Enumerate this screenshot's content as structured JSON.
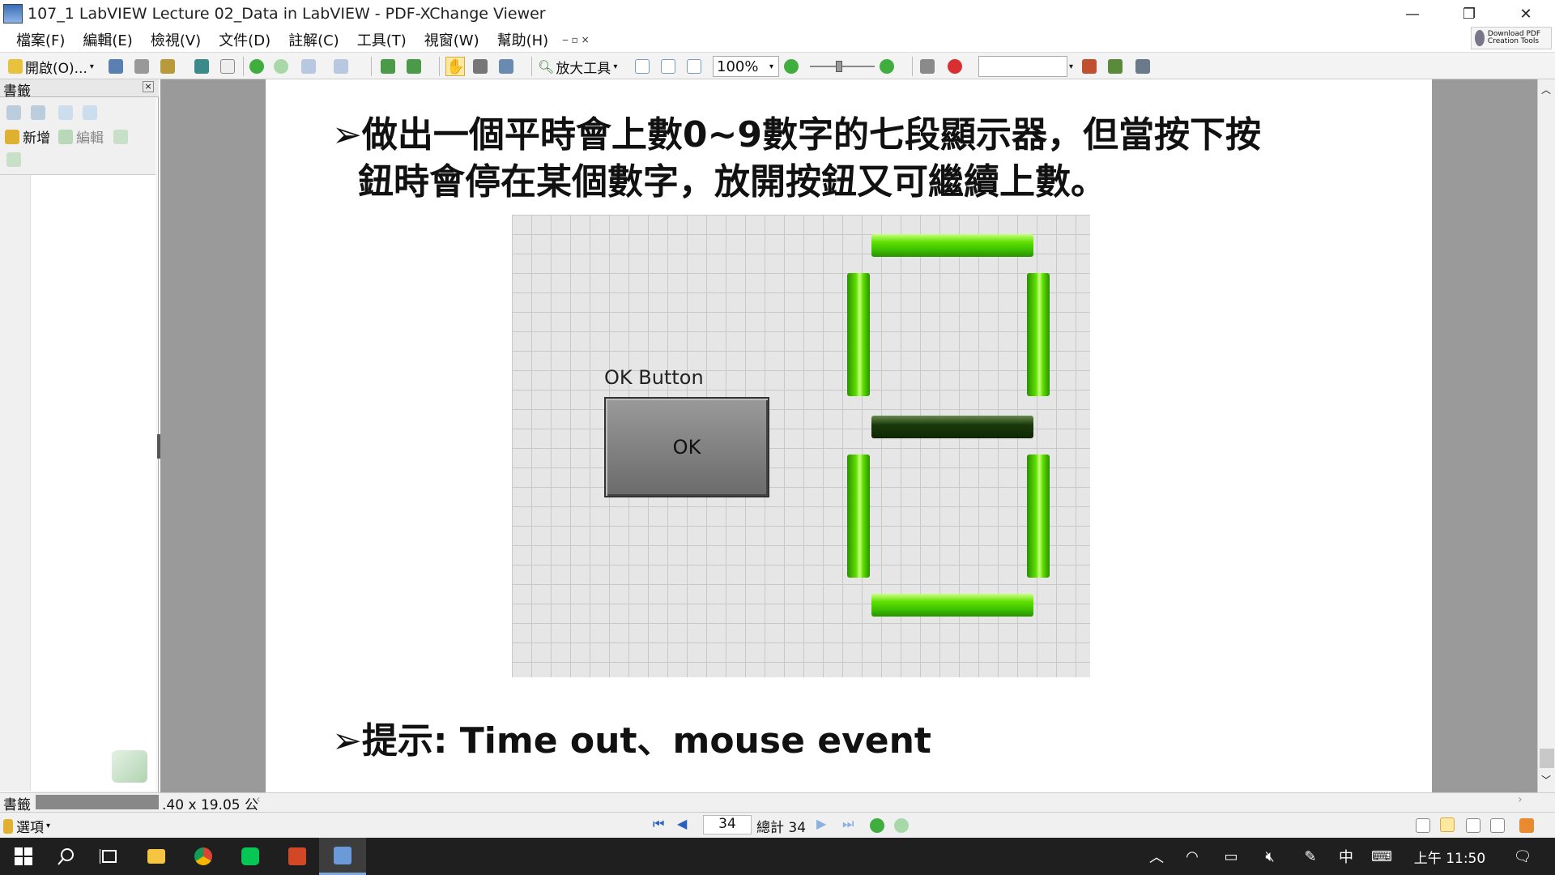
{
  "window": {
    "title": "107_1 LabVIEW Lecture 02_Data in LabVIEW - PDF-XChange Viewer",
    "minimize": "—",
    "restore": "❐",
    "close": "✕"
  },
  "menubar": {
    "items": [
      "檔案(F)",
      "編輯(E)",
      "檢視(V)",
      "文件(D)",
      "註解(C)",
      "工具(T)",
      "視窗(W)",
      "幫助(H)"
    ],
    "mdi_controls": "‒ ▫ ×",
    "promo_text": "Download PDF Creation Tools"
  },
  "toolbar": {
    "open_label": "開啟(O)...",
    "zoom_tool_label": "放大工具",
    "zoom_value": "100%",
    "search_value": ""
  },
  "bookmarks": {
    "panel_title": "書籤",
    "new_label": "新增",
    "edit_label": "編輯",
    "tab_label": "書籤",
    "options_label": "選項"
  },
  "slide": {
    "bullet1_line1": "做出一個平時會上數0~9數字的七段顯示器，但當按下按",
    "bullet1_line2": "鈕時會停在某個數字，放開按鈕又可繼續上數。",
    "bullet2": "提示: Time out、mouse event",
    "bullet_marker": "➢",
    "ok_button_label": "OK Button",
    "ok_button_text": "OK",
    "seven_segment": {
      "lit_color": "#5fe000",
      "unlit_color": "#1a3a0a",
      "segments_on": [
        "a",
        "b",
        "c",
        "d",
        "e",
        "f"
      ],
      "segments_off": [
        "g"
      ]
    }
  },
  "status": {
    "page_size": ".40 x 19.05 公"
  },
  "navigation": {
    "current_page": "34",
    "total_label": "總計 34"
  },
  "taskbar": {
    "time": "上午 11:50",
    "ime_mode": "中"
  }
}
